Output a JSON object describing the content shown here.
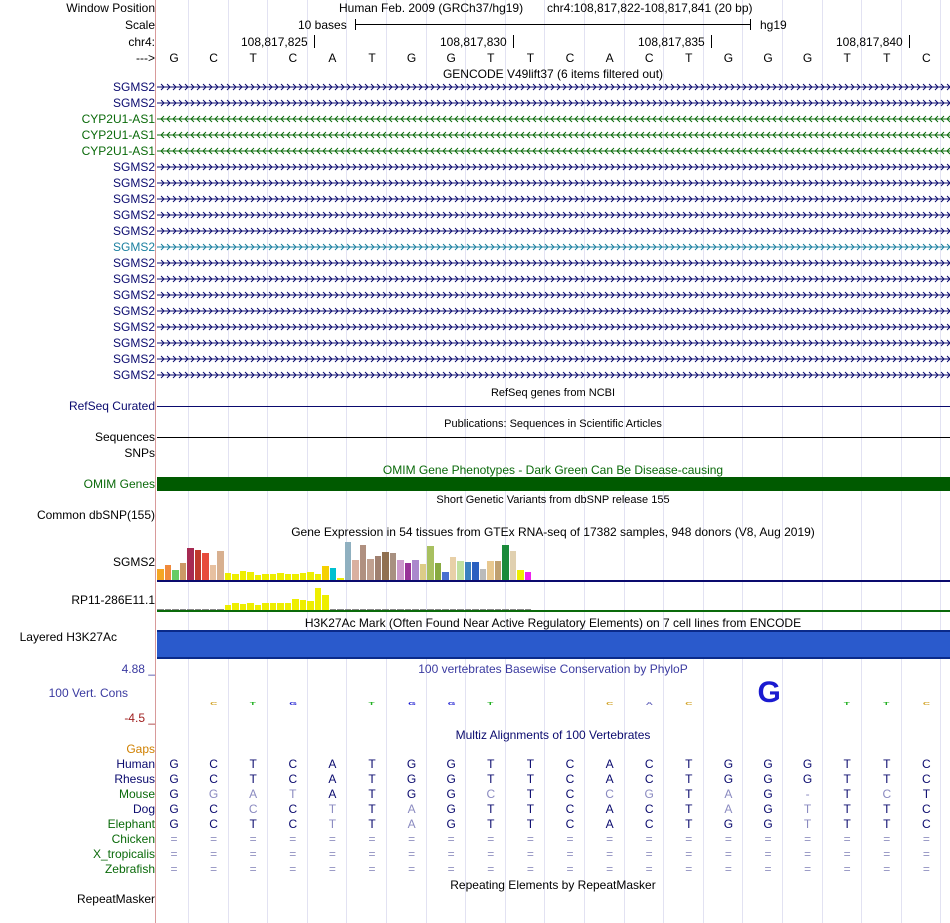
{
  "sidebar": {
    "window_position": "Window Position",
    "scale": "Scale",
    "chrom": "chr4:",
    "strand_arrow": "--->"
  },
  "header": {
    "assembly": "Human Feb. 2009 (GRCh37/hg19)",
    "position": "chr4:108,817,822-108,817,841 (20 bp)",
    "scale_label": "10 bases",
    "db": "hg19",
    "coords": [
      "108,817,825",
      "108,817,830",
      "108,817,835",
      "108,817,840"
    ]
  },
  "bases": [
    "G",
    "C",
    "T",
    "C",
    "A",
    "T",
    "G",
    "G",
    "T",
    "T",
    "C",
    "A",
    "C",
    "T",
    "G",
    "G",
    "G",
    "T",
    "T",
    "C"
  ],
  "gencode": {
    "title": "GENCODE V49lift37 (6 items filtered out)",
    "rows": [
      {
        "name": "SGMS2",
        "strand": "+",
        "color": "#0a0a6e"
      },
      {
        "name": "SGMS2",
        "strand": "+",
        "color": "#0a0a6e"
      },
      {
        "name": "CYP2U1-AS1",
        "strand": "-",
        "color": "#0a6a0a"
      },
      {
        "name": "CYP2U1-AS1",
        "strand": "-",
        "color": "#0a6a0a"
      },
      {
        "name": "CYP2U1-AS1",
        "strand": "-",
        "color": "#0a6a0a"
      },
      {
        "name": "SGMS2",
        "strand": "+",
        "color": "#0a0a6e"
      },
      {
        "name": "SGMS2",
        "strand": "+",
        "color": "#0a0a6e"
      },
      {
        "name": "SGMS2",
        "strand": "+",
        "color": "#0a0a6e"
      },
      {
        "name": "SGMS2",
        "strand": "+",
        "color": "#0a0a6e"
      },
      {
        "name": "SGMS2",
        "strand": "+",
        "color": "#0a0a6e"
      },
      {
        "name": "SGMS2",
        "strand": "+",
        "color": "#1a7fa0"
      },
      {
        "name": "SGMS2",
        "strand": "+",
        "color": "#0a0a6e"
      },
      {
        "name": "SGMS2",
        "strand": "+",
        "color": "#0a0a6e"
      },
      {
        "name": "SGMS2",
        "strand": "+",
        "color": "#0a0a6e"
      },
      {
        "name": "SGMS2",
        "strand": "+",
        "color": "#0a0a6e"
      },
      {
        "name": "SGMS2",
        "strand": "+",
        "color": "#0a0a6e"
      },
      {
        "name": "SGMS2",
        "strand": "+",
        "color": "#0a0a6e"
      },
      {
        "name": "SGMS2",
        "strand": "+",
        "color": "#0a0a6e"
      },
      {
        "name": "SGMS2",
        "strand": "+",
        "color": "#0a0a6e"
      }
    ]
  },
  "tracks": {
    "refseq_title": "RefSeq genes from NCBI",
    "refseq_label": "RefSeq Curated",
    "pubs_title": "Publications: Sequences in Scientific Articles",
    "pubs_label": "Sequences",
    "snps_label": "SNPs",
    "omim_title": "OMIM Gene Phenotypes - Dark Green Can Be Disease-causing",
    "omim_label": "OMIM Genes",
    "dbsnp_title": "Short Genetic Variants from dbSNP release 155",
    "dbsnp_label": "Common dbSNP(155)",
    "gtex_title": "Gene Expression in 54 tissues from GTEx RNA-seq of 17382 samples, 948 donors (V8, Aug 2019)",
    "gtex_gene1": "SGMS2",
    "gtex_gene2": "RP11-286E11.1",
    "h3k27_title": "H3K27Ac Mark (Often Found Near Active Regulatory Elements) on 7 cell lines from ENCODE",
    "h3k27_label": "Layered H3K27Ac",
    "phylop_title": "100 vertebrates Basewise Conservation by PhyloP",
    "phylop_label": "100 Vert. Cons",
    "phylop_max": "4.88 _",
    "phylop_min": "-4.5 _",
    "multiz_title": "Multiz Alignments of 100 Vertebrates",
    "gaps_label": "Gaps",
    "rmsk_title": "Repeating Elements by RepeatMasker",
    "rmsk_label": "RepeatMasker"
  },
  "phylop_glyphs": [
    {
      "base": "C",
      "idx": 1
    },
    {
      "base": "T",
      "idx": 2
    },
    {
      "base": "G",
      "idx": 3
    },
    {
      "base": "T",
      "idx": 5
    },
    {
      "base": "G",
      "idx": 6
    },
    {
      "base": "G",
      "idx": 7
    },
    {
      "base": "T",
      "idx": 8
    },
    {
      "base": "C",
      "idx": 11
    },
    {
      "base": "A",
      "idx": 12
    },
    {
      "base": "C",
      "idx": 13
    },
    {
      "base": "G",
      "idx": 15
    },
    {
      "base": "T",
      "idx": 17
    },
    {
      "base": "T",
      "idx": 18
    },
    {
      "base": "C",
      "idx": 19
    }
  ],
  "gtex": {
    "sgms2": [
      {
        "v": 0.28,
        "c": "#f5a623"
      },
      {
        "v": 0.38,
        "c": "#f08a3c"
      },
      {
        "v": 0.24,
        "c": "#66cc66"
      },
      {
        "v": 0.42,
        "c": "#cc9966"
      },
      {
        "v": 0.8,
        "c": "#a62a52"
      },
      {
        "v": 0.75,
        "c": "#c0392b"
      },
      {
        "v": 0.68,
        "c": "#e74c3c"
      },
      {
        "v": 0.38,
        "c": "#e7c0a0"
      },
      {
        "v": 0.72,
        "c": "#d8b090"
      },
      {
        "v": 0.18,
        "c": "#eeee00"
      },
      {
        "v": 0.14,
        "c": "#eeee00"
      },
      {
        "v": 0.22,
        "c": "#eeee00"
      },
      {
        "v": 0.2,
        "c": "#eeee00"
      },
      {
        "v": 0.12,
        "c": "#eeee00"
      },
      {
        "v": 0.16,
        "c": "#eeee00"
      },
      {
        "v": 0.14,
        "c": "#eeee00"
      },
      {
        "v": 0.18,
        "c": "#eeee00"
      },
      {
        "v": 0.16,
        "c": "#eeee00"
      },
      {
        "v": 0.14,
        "c": "#eeee00"
      },
      {
        "v": 0.18,
        "c": "#eeee00"
      },
      {
        "v": 0.2,
        "c": "#eeee00"
      },
      {
        "v": 0.16,
        "c": "#eeee00"
      },
      {
        "v": 0.36,
        "c": "#f5d000"
      },
      {
        "v": 0.3,
        "c": "#00c0d0"
      },
      {
        "v": 0.05,
        "c": "#eeee00"
      },
      {
        "v": 0.95,
        "c": "#8fb0c0"
      },
      {
        "v": 0.5,
        "c": "#d9b0a0"
      },
      {
        "v": 0.88,
        "c": "#b09080"
      },
      {
        "v": 0.52,
        "c": "#c0a090"
      },
      {
        "v": 0.6,
        "c": "#a08070"
      },
      {
        "v": 0.7,
        "c": "#907050"
      },
      {
        "v": 0.68,
        "c": "#a89080"
      },
      {
        "v": 0.5,
        "c": "#cc99cc"
      },
      {
        "v": 0.42,
        "c": "#993399"
      },
      {
        "v": 0.5,
        "c": "#aa88cc"
      },
      {
        "v": 0.4,
        "c": "#ddcc88"
      },
      {
        "v": 0.86,
        "c": "#a8c060"
      },
      {
        "v": 0.42,
        "c": "#88aa40"
      },
      {
        "v": 0.2,
        "c": "#4a70d0"
      },
      {
        "v": 0.58,
        "c": "#e8d0a8"
      },
      {
        "v": 0.48,
        "c": "#c0e0a0"
      },
      {
        "v": 0.46,
        "c": "#3a80c0"
      },
      {
        "v": 0.44,
        "c": "#2a60c0"
      },
      {
        "v": 0.28,
        "c": "#bbbbbb"
      },
      {
        "v": 0.48,
        "c": "#e8c890"
      },
      {
        "v": 0.48,
        "c": "#c0a070"
      },
      {
        "v": 0.88,
        "c": "#1a8a3a"
      },
      {
        "v": 0.72,
        "c": "#e0d0b0"
      },
      {
        "v": 0.26,
        "c": "#eeee00"
      },
      {
        "v": 0.2,
        "c": "#ee22ee"
      }
    ],
    "rp11": [
      {
        "v": 0.02,
        "c": "#888888"
      },
      {
        "v": 0.02,
        "c": "#888888"
      },
      {
        "v": 0.02,
        "c": "#888888"
      },
      {
        "v": 0.02,
        "c": "#888888"
      },
      {
        "v": 0.02,
        "c": "#888888"
      },
      {
        "v": 0.02,
        "c": "#888888"
      },
      {
        "v": 0.02,
        "c": "#888888"
      },
      {
        "v": 0.02,
        "c": "#888888"
      },
      {
        "v": 0.02,
        "c": "#888888"
      },
      {
        "v": 0.2,
        "c": "#eeee00"
      },
      {
        "v": 0.3,
        "c": "#eeee00"
      },
      {
        "v": 0.24,
        "c": "#eeee00"
      },
      {
        "v": 0.3,
        "c": "#eeee00"
      },
      {
        "v": 0.2,
        "c": "#eeee00"
      },
      {
        "v": 0.28,
        "c": "#eeee00"
      },
      {
        "v": 0.3,
        "c": "#eeee00"
      },
      {
        "v": 0.28,
        "c": "#eeee00"
      },
      {
        "v": 0.3,
        "c": "#eeee00"
      },
      {
        "v": 0.46,
        "c": "#eeee00"
      },
      {
        "v": 0.42,
        "c": "#eeee00"
      },
      {
        "v": 0.38,
        "c": "#eeee00"
      },
      {
        "v": 0.9,
        "c": "#eeee00"
      },
      {
        "v": 0.6,
        "c": "#eeee00"
      },
      {
        "v": 0.02,
        "c": "#888888"
      },
      {
        "v": 0.02,
        "c": "#888888"
      },
      {
        "v": 0.02,
        "c": "#888888"
      },
      {
        "v": 0.02,
        "c": "#888888"
      },
      {
        "v": 0.02,
        "c": "#888888"
      },
      {
        "v": 0.02,
        "c": "#888888"
      },
      {
        "v": 0.02,
        "c": "#888888"
      },
      {
        "v": 0.02,
        "c": "#888888"
      },
      {
        "v": 0.02,
        "c": "#888888"
      },
      {
        "v": 0.02,
        "c": "#888888"
      },
      {
        "v": 0.02,
        "c": "#888888"
      },
      {
        "v": 0.02,
        "c": "#888888"
      },
      {
        "v": 0.02,
        "c": "#888888"
      },
      {
        "v": 0.02,
        "c": "#888888"
      },
      {
        "v": 0.02,
        "c": "#888888"
      },
      {
        "v": 0.02,
        "c": "#888888"
      },
      {
        "v": 0.02,
        "c": "#888888"
      },
      {
        "v": 0.02,
        "c": "#888888"
      },
      {
        "v": 0.02,
        "c": "#888888"
      },
      {
        "v": 0.02,
        "c": "#888888"
      },
      {
        "v": 0.02,
        "c": "#888888"
      },
      {
        "v": 0.02,
        "c": "#888888"
      },
      {
        "v": 0.02,
        "c": "#888888"
      },
      {
        "v": 0.02,
        "c": "#888888"
      },
      {
        "v": 0.02,
        "c": "#888888"
      },
      {
        "v": 0.02,
        "c": "#888888"
      },
      {
        "v": 0.02,
        "c": "#888888"
      }
    ]
  },
  "multiz": {
    "species": [
      {
        "name": "Human",
        "color": "#0a0a6e",
        "seq": [
          "G",
          "C",
          "T",
          "C",
          "A",
          "T",
          "G",
          "G",
          "T",
          "T",
          "C",
          "A",
          "C",
          "T",
          "G",
          "G",
          "G",
          "T",
          "T",
          "C"
        ]
      },
      {
        "name": "Rhesus",
        "color": "#0a0a6e",
        "seq": [
          "G",
          "C",
          "T",
          "C",
          "A",
          "T",
          "G",
          "G",
          "T",
          "T",
          "C",
          "A",
          "C",
          "T",
          "G",
          "G",
          "G",
          "T",
          "T",
          "C"
        ]
      },
      {
        "name": "Mouse",
        "color": "#0a6a0a",
        "seq": [
          "G",
          "G",
          "A",
          "T",
          "A",
          "T",
          "G",
          "G",
          "C",
          "T",
          "C",
          "C",
          "G",
          "T",
          "A",
          "G",
          "-",
          "T",
          "C",
          "T"
        ],
        "match": [
          1,
          0,
          0,
          0,
          1,
          1,
          1,
          1,
          0,
          1,
          1,
          0,
          0,
          1,
          0,
          1,
          0,
          1,
          0,
          1
        ]
      },
      {
        "name": "Dog",
        "color": "#0a0a6e",
        "seq": [
          "G",
          "C",
          "C",
          "C",
          "T",
          "T",
          "A",
          "G",
          "T",
          "T",
          "C",
          "A",
          "C",
          "T",
          "A",
          "G",
          "T",
          "T",
          "T",
          "C"
        ],
        "match": [
          1,
          1,
          0,
          1,
          0,
          1,
          0,
          1,
          1,
          1,
          1,
          1,
          1,
          1,
          0,
          1,
          0,
          1,
          1,
          1
        ]
      },
      {
        "name": "Elephant",
        "color": "#0a6a0a",
        "seq": [
          "G",
          "C",
          "T",
          "C",
          "T",
          "T",
          "A",
          "G",
          "T",
          "T",
          "C",
          "A",
          "C",
          "T",
          "G",
          "G",
          "T",
          "T",
          "T",
          "C"
        ],
        "match": [
          1,
          1,
          1,
          1,
          0,
          1,
          0,
          1,
          1,
          1,
          1,
          1,
          1,
          1,
          1,
          1,
          0,
          1,
          1,
          1
        ]
      },
      {
        "name": "Chicken",
        "color": "#0a6a0a",
        "seq": [
          "=",
          "=",
          "=",
          "=",
          "=",
          "=",
          "=",
          "=",
          "=",
          "=",
          "=",
          "=",
          "=",
          "=",
          "=",
          "=",
          "=",
          "=",
          "=",
          "="
        ],
        "match": [
          0,
          0,
          0,
          0,
          0,
          0,
          0,
          0,
          0,
          0,
          0,
          0,
          0,
          0,
          0,
          0,
          0,
          0,
          0,
          0
        ]
      },
      {
        "name": "X_tropicalis",
        "color": "#0a6a0a",
        "seq": [
          "=",
          "=",
          "=",
          "=",
          "=",
          "=",
          "=",
          "=",
          "=",
          "=",
          "=",
          "=",
          "=",
          "=",
          "=",
          "=",
          "=",
          "=",
          "=",
          "="
        ],
        "match": [
          0,
          0,
          0,
          0,
          0,
          0,
          0,
          0,
          0,
          0,
          0,
          0,
          0,
          0,
          0,
          0,
          0,
          0,
          0,
          0
        ]
      },
      {
        "name": "Zebrafish",
        "color": "#0a6a0a",
        "seq": [
          "=",
          "=",
          "=",
          "=",
          "=",
          "=",
          "=",
          "=",
          "=",
          "=",
          "=",
          "=",
          "=",
          "=",
          "=",
          "=",
          "=",
          "=",
          "=",
          "="
        ],
        "match": [
          0,
          0,
          0,
          0,
          0,
          0,
          0,
          0,
          0,
          0,
          0,
          0,
          0,
          0,
          0,
          0,
          0,
          0,
          0,
          0
        ]
      }
    ]
  },
  "colors": {
    "navy": "#0a0a6e",
    "omim_green": "#005a00",
    "h3k27_blue": "#2a5acc",
    "gaps": "#d08000",
    "phylop_label": "#3a3aa0",
    "phylop_neg": "#a02020"
  }
}
